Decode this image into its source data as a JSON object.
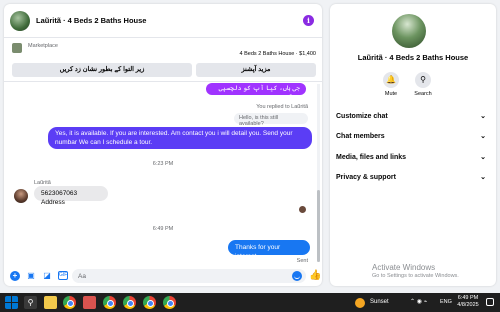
{
  "chat": {
    "title": "Laũritã · 4 Beds 2 Baths House",
    "marketplace_label": "Marketplace",
    "listing": "4 Beds 2 Baths House · $1,400",
    "button_mark": "زیر التوا کے بطور نشان زد کریں",
    "button_more": "مزید آپشنز"
  },
  "messages": {
    "urdu_msg": "جی ہاں، کیا آپ کو دلچسپی ہے؟",
    "reply_note": "You replied to Laũritã",
    "reply_quote": "Hello, is this still available?",
    "long_msg": "Yes, it is available. If you are interested. Am contact you i will detail you. Send your numbar We can I schedule a tour.",
    "time1": "6:23 PM",
    "sender_name": "Laũritã",
    "in_msg": "5623067063 Address",
    "time2": "6:49 PM",
    "thanks_msg": "Thanks for your interest",
    "sent_status": "Sent"
  },
  "composer": {
    "placeholder": "Aa"
  },
  "side": {
    "title": "Laũritã · 4 Beds 2 Baths House",
    "mute": "Mute",
    "search": "Search",
    "sections": [
      "Customize chat",
      "Chat members",
      "Media, files and links",
      "Privacy & support"
    ],
    "activate_title": "Activate Windows",
    "activate_sub": "Go to Settings to activate Windows."
  },
  "taskbar": {
    "weather": "Sunset",
    "lang": "ENG",
    "time": "6:49 PM",
    "date": "4/8/2025"
  },
  "colors": {
    "messenger_blue": "#1877f2",
    "purple_bubble": "#5b3df5",
    "urdu_bubble": "#a033ff"
  }
}
